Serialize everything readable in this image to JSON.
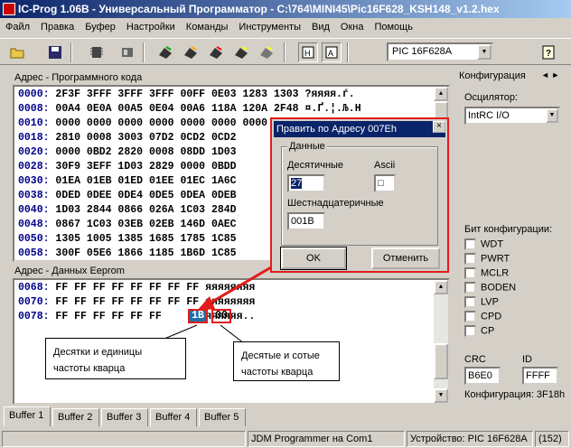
{
  "window": {
    "title": "IC-Prog 1.06B - Универсальный Программатор - C:\\764\\MINI45\\Pic16F628_KSH148_v1.2.hex"
  },
  "menu": [
    "Файл",
    "Правка",
    "Буфер",
    "Настройки",
    "Команды",
    "Инструменты",
    "Вид",
    "Окна",
    "Помощь"
  ],
  "toolbar": {
    "device": "PIC 16F628A",
    "icons": [
      "open-icon",
      "save-icon",
      "chip-read-icon",
      "program-chip-icon",
      "verify-chip-icon",
      "erase-chip-icon",
      "blank-check-icon",
      "view-hex-icon",
      "view-asm-icon",
      "help-icon"
    ]
  },
  "code": {
    "header": "Адрес - Программного кода",
    "rows": [
      {
        "addr": "0000:",
        "data": "2F3F 3FFF 3FFF 3FFF 00FF 0E03 1283 1303",
        "ascii": "?яяяя.ѓ."
      },
      {
        "addr": "0008:",
        "data": "00A4 0E0A 00A5 0E04 00A6 118A 120A 2F48",
        "ascii": "¤.Ґ.¦.Љ.H"
      },
      {
        "addr": "0010:",
        "data": "0000 0000 0000 0000 0000 0000 0000 0000",
        "ascii": ""
      },
      {
        "addr": "0018:",
        "data": "2810 0008 3003 07D2 0CD2 0CD2",
        "ascii": ""
      },
      {
        "addr": "0020:",
        "data": "0000 0BD2 2820 0008 08DD 1D03",
        "ascii": ""
      },
      {
        "addr": "0028:",
        "data": "30F9 3EFF 1D03 2829 0000 0BDD",
        "ascii": ""
      },
      {
        "addr": "0030:",
        "data": "01EA 01EB 01ED 01EE 01EC 1A6C",
        "ascii": ""
      },
      {
        "addr": "0038:",
        "data": "0DED 0DEE 0DE4 0DE5 0DEA 0DEB",
        "ascii": ""
      },
      {
        "addr": "0040:",
        "data": "1D03 2844 0866 026A 1C03 284D",
        "ascii": ""
      },
      {
        "addr": "0048:",
        "data": "0867 1C03 03EB 02EB 146D 0AEC",
        "ascii": ""
      },
      {
        "addr": "0050:",
        "data": "1305 1005 1385 1685 1785 1C85",
        "ascii": ""
      },
      {
        "addr": "0058:",
        "data": "300F 05E6 1866 1185 1B6D 1C85",
        "ascii": ""
      }
    ]
  },
  "eeprom": {
    "header": "Адрес - Данных Eeprom",
    "rows": [
      {
        "addr": "0068:",
        "data": "FF FF FF FF FF FF FF FF",
        "ascii": "яяяяяяяя"
      },
      {
        "addr": "0070:",
        "data": "FF FF FF FF FF FF FF FF",
        "ascii": "яяяяяяяя"
      },
      {
        "addr": "0078:",
        "data": "FF FF FF FF FF FF",
        "b1": "1B",
        "b2": "00",
        "ascii": "яяяяяя.."
      }
    ]
  },
  "dialog": {
    "title": "Править по Адресу 007Eh",
    "group_label": "Данные",
    "decimal_label": "Десятичные",
    "decimal_value": "27",
    "ascii_label": "Ascii",
    "ascii_value": "□",
    "hex_label": "Шестнадцатеричные",
    "hex_value": "001B",
    "ok": "OK",
    "cancel": "Отменить"
  },
  "callouts": {
    "left": "Десятки и единицы частоты кварца",
    "right": "Десятые и сотые частоты кварца"
  },
  "config": {
    "tab": "Конфигурация",
    "osc_label": "Осцилятор:",
    "osc_value": "IntRC I/O",
    "bits_label": "Бит конфигурации:",
    "bits": [
      "WDT",
      "PWRT",
      "MCLR",
      "BODEN",
      "LVP",
      "CPD",
      "CP"
    ],
    "crc_label": "CRC",
    "crc_value": "B6E0",
    "id_label": "ID",
    "id_value": "FFFF",
    "conf_text": "Конфигурация: 3F18h"
  },
  "buffers": [
    "Buffer 1",
    "Buffer 2",
    "Buffer 3",
    "Buffer 4",
    "Buffer 5"
  ],
  "status": {
    "programmer": "JDM Programmer на Com1",
    "device": "Устройство: PIC 16F628A",
    "count": "(152)"
  },
  "colors": {
    "accent": "#0a246a",
    "highlight": "#e31b1b",
    "selection": "#1e6fa8"
  }
}
